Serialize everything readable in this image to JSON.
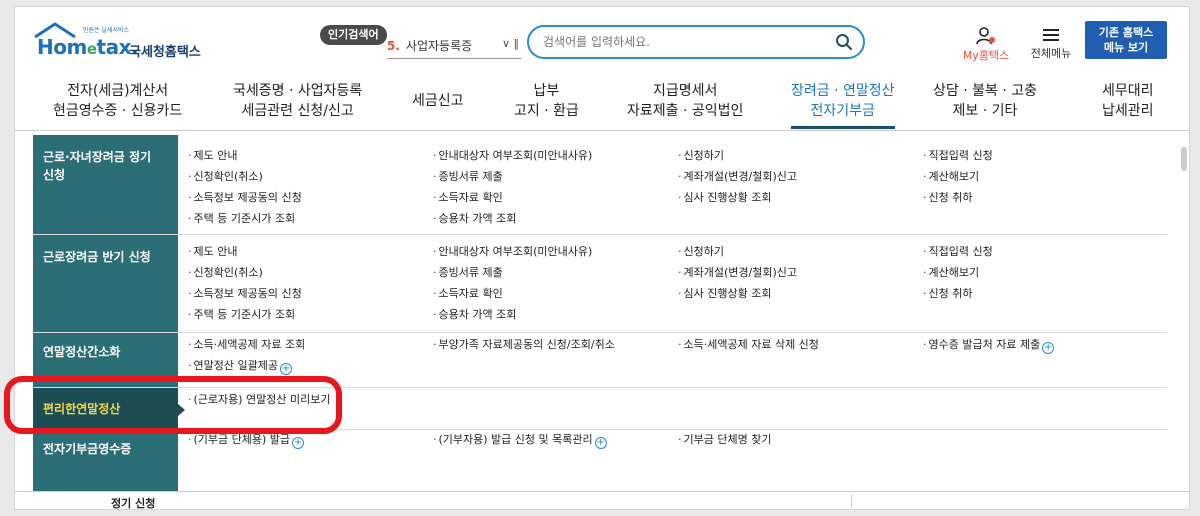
{
  "header": {
    "logo_text": "Hometax.",
    "logo_tag": "민원은 날세서비스",
    "logo_org": "국세청홈택스",
    "popular_label": "인기검색어",
    "rank_num": "5.",
    "rank_text": "사업자등록증",
    "search_placeholder": "검색어를 입력하세요.",
    "mytax_label": "My홈택스",
    "allmenu_label": "전체메뉴",
    "oldhome_line1": "기존 홈택스",
    "oldhome_line2": "메뉴 보기"
  },
  "nav": [
    {
      "line1": "전자(세금)계산서",
      "line2": "현금영수증 · 신용카드"
    },
    {
      "line1": "국세증명 · 사업자등록",
      "line2": "세금관련 신청/신고"
    },
    {
      "line1": "세금신고",
      "line2": ""
    },
    {
      "line1": "납부",
      "line2": "고지 · 환급"
    },
    {
      "line1": "지급명세서",
      "line2": "자료제출 · 공익법인"
    },
    {
      "line1": "장려금 · 연말정산",
      "line2": "전자기부금"
    },
    {
      "line1": "상담 · 불복 · 고충",
      "line2": "제보 · 기타"
    },
    {
      "line1": "세무대리",
      "line2": "납세관리"
    }
  ],
  "rows": [
    {
      "head": "근로·자녀장려금 정기 신청",
      "cols": [
        [
          "제도 안내",
          "신청확인(취소)",
          "소득정보 제공동의 신청",
          "주택 등 기준시가 조회"
        ],
        [
          "안내대상자 여부조회(미안내사유)",
          "증빙서류 제출",
          "소득자료 확인",
          "승용차 가액 조회"
        ],
        [
          "신청하기",
          "계좌개설(변경/철회)신고",
          "심사 진행상황 조회"
        ],
        [
          "직접입력 신청",
          "계산해보기",
          "신청 취하"
        ]
      ]
    },
    {
      "head": "근로장려금 반기 신청",
      "cols": [
        [
          "제도 안내",
          "신청확인(취소)",
          "소득정보 제공동의 신청",
          "주택 등 기준시가 조회"
        ],
        [
          "안내대상자 여부조회(미안내사유)",
          "증빙서류 제출",
          "소득자료 확인",
          "승용차 가액 조회"
        ],
        [
          "신청하기",
          "계좌개설(변경/철회)신고",
          "심사 진행상황 조회"
        ],
        [
          "직접입력 신청",
          "계산해보기",
          "신청 취하"
        ]
      ]
    },
    {
      "head": "연말정산간소화",
      "cols": [
        [
          "소득·세액공제 자료 조회",
          "연말정산 일괄제공"
        ],
        [
          "부양가족 자료제공동의 신청/조회/취소"
        ],
        [
          "소득·세액공제 자료 삭제 신청"
        ],
        [
          "영수증 발급처 자료 제출"
        ]
      ]
    },
    {
      "head": "편리한연말정산",
      "cols": [
        [
          "(근로자용) 연말정산 미리보기"
        ]
      ]
    },
    {
      "head": "전자기부금영수증",
      "cols": [
        [
          "(기부금 단체용) 발급"
        ],
        [
          "(기부자용) 발급 신청 및 목록관리"
        ],
        [
          "기부금 단체명 찾기"
        ]
      ]
    }
  ],
  "bottom_label": "정기 신청",
  "colors": {
    "accent": "#2b6e76",
    "highlight": "#e8161d",
    "active_nav": "#1f78b4"
  }
}
